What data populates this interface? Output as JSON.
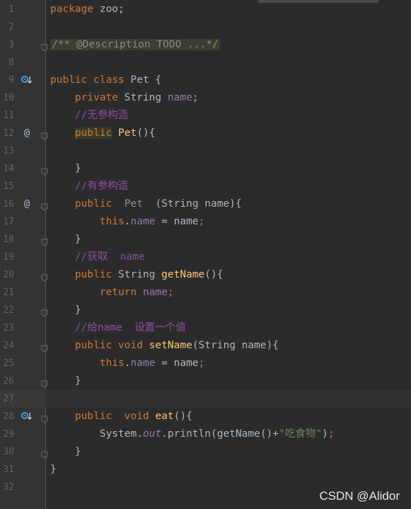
{
  "lines": [
    {
      "num": "1",
      "parts": [
        [
          "kw",
          "package"
        ],
        [
          "plain",
          " zoo;"
        ]
      ]
    },
    {
      "num": "2",
      "parts": []
    },
    {
      "num": "3",
      "fold": true,
      "parts": [
        [
          "foldeddoc",
          "/** @Description TODO ...*/"
        ]
      ]
    },
    {
      "num": "8",
      "parts": []
    },
    {
      "num": "9",
      "marker": "override-icon",
      "parts": [
        [
          "kw",
          "public"
        ],
        [
          "plain",
          " "
        ],
        [
          "kw",
          "class"
        ],
        [
          "plain",
          " Pet {"
        ]
      ]
    },
    {
      "num": "10",
      "parts": [
        [
          "plain",
          "    "
        ],
        [
          "kw",
          "private"
        ],
        [
          "plain",
          " String "
        ],
        [
          "field",
          "name"
        ],
        [
          "plain",
          ";"
        ]
      ]
    },
    {
      "num": "11",
      "parts": [
        [
          "plain",
          "    "
        ],
        [
          "cmt",
          "//无参构造"
        ]
      ]
    },
    {
      "num": "12",
      "marker": "at",
      "fold": true,
      "parts": [
        [
          "plain",
          "    "
        ],
        [
          "kwhl",
          "public"
        ],
        [
          "plain",
          " "
        ],
        [
          "fn",
          "Pet"
        ],
        [
          "plain",
          "(){"
        ]
      ]
    },
    {
      "num": "13",
      "parts": []
    },
    {
      "num": "14",
      "fold": true,
      "parts": [
        [
          "plain",
          "    }"
        ]
      ]
    },
    {
      "num": "15",
      "parts": [
        [
          "plain",
          "    "
        ],
        [
          "cmt",
          "//有参构造"
        ]
      ]
    },
    {
      "num": "16",
      "marker": "at",
      "fold": true,
      "parts": [
        [
          "plain",
          "    "
        ],
        [
          "kw",
          "public"
        ],
        [
          "plain",
          "  "
        ],
        [
          "dim",
          "Pet"
        ],
        [
          "plain",
          "  (String name){"
        ]
      ]
    },
    {
      "num": "17",
      "parts": [
        [
          "plain",
          "        "
        ],
        [
          "kw",
          "this"
        ],
        [
          "plain",
          "."
        ],
        [
          "field",
          "name"
        ],
        [
          "plain",
          " = name"
        ],
        [
          "kw",
          ";"
        ]
      ]
    },
    {
      "num": "18",
      "fold": true,
      "parts": [
        [
          "plain",
          "    }"
        ]
      ]
    },
    {
      "num": "19",
      "parts": [
        [
          "plain",
          "    "
        ],
        [
          "cmt",
          "//获取  name"
        ]
      ]
    },
    {
      "num": "20",
      "fold": true,
      "parts": [
        [
          "plain",
          "    "
        ],
        [
          "kw",
          "public"
        ],
        [
          "plain",
          " String "
        ],
        [
          "fn",
          "getName"
        ],
        [
          "plain",
          "(){"
        ]
      ]
    },
    {
      "num": "21",
      "parts": [
        [
          "plain",
          "        "
        ],
        [
          "kw",
          "return"
        ],
        [
          "plain",
          " "
        ],
        [
          "field",
          "name"
        ],
        [
          "kw",
          ";"
        ]
      ]
    },
    {
      "num": "22",
      "fold": true,
      "parts": [
        [
          "plain",
          "    }"
        ]
      ]
    },
    {
      "num": "23",
      "parts": [
        [
          "plain",
          "    "
        ],
        [
          "cmt",
          "//给name  设置一个值"
        ]
      ]
    },
    {
      "num": "24",
      "fold": true,
      "parts": [
        [
          "plain",
          "    "
        ],
        [
          "kw",
          "public"
        ],
        [
          "plain",
          " "
        ],
        [
          "kw",
          "void"
        ],
        [
          "plain",
          " "
        ],
        [
          "fn",
          "setName"
        ],
        [
          "plain",
          "(String name){"
        ]
      ]
    },
    {
      "num": "25",
      "parts": [
        [
          "plain",
          "        "
        ],
        [
          "kw",
          "this"
        ],
        [
          "plain",
          "."
        ],
        [
          "field",
          "name"
        ],
        [
          "plain",
          " = name"
        ],
        [
          "kw",
          ";"
        ]
      ]
    },
    {
      "num": "26",
      "fold": true,
      "parts": [
        [
          "plain",
          "    }"
        ]
      ]
    },
    {
      "num": "27",
      "current": true,
      "parts": []
    },
    {
      "num": "28",
      "marker": "override-icon",
      "fold": true,
      "parts": [
        [
          "plain",
          "    "
        ],
        [
          "kw",
          "public"
        ],
        [
          "plain",
          "  "
        ],
        [
          "kw",
          "void"
        ],
        [
          "plain",
          " "
        ],
        [
          "fn",
          "eat"
        ],
        [
          "plain",
          "(){"
        ]
      ]
    },
    {
      "num": "29",
      "parts": [
        [
          "plain",
          "        System."
        ],
        [
          "fielditalic",
          "out"
        ],
        [
          "plain",
          ".println(getName()+"
        ],
        [
          "str",
          "\"吃食物\""
        ],
        [
          "plain",
          ")"
        ],
        [
          "kw",
          ";"
        ]
      ]
    },
    {
      "num": "30",
      "fold": true,
      "parts": [
        [
          "plain",
          "    }"
        ]
      ]
    },
    {
      "num": "31",
      "parts": [
        [
          "plain",
          "}"
        ]
      ]
    },
    {
      "num": "32",
      "parts": []
    }
  ],
  "watermark": "CSDN @Alidor",
  "colors": {
    "background": "#2b2b2b",
    "keyword": "#cc7832",
    "function": "#ffc66d",
    "field": "#9876aa",
    "string": "#6a8759",
    "comment": "#8f4ba3",
    "text": "#a9b7c6"
  }
}
